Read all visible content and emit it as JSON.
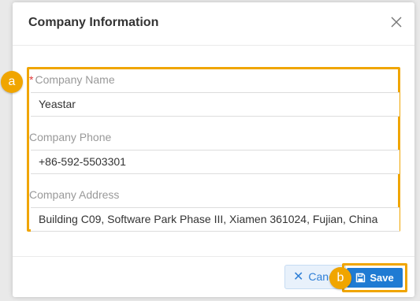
{
  "dialog": {
    "title": "Company Information"
  },
  "form": {
    "required_mark": "*",
    "company_name": {
      "label": "Company Name",
      "value": "Yeastar"
    },
    "company_phone": {
      "label": "Company Phone",
      "value": "+86-592-5503301"
    },
    "company_address": {
      "label": "Company Address",
      "value": "Building C09, Software Park Phase III, Xiamen 361024, Fujian, China"
    }
  },
  "footer": {
    "cancel_label": "Cancel",
    "save_label": "Save"
  },
  "annotations": {
    "marker_a": "a",
    "marker_b": "b",
    "highlight_color": "#f0a500"
  },
  "icons": {
    "close": "close-icon",
    "cancel": "x-icon",
    "save": "floppy-disk-icon"
  },
  "colors": {
    "primary": "#1f7bd3",
    "title_text": "#333333",
    "label_text": "#999999",
    "required": "#e03a3a"
  }
}
